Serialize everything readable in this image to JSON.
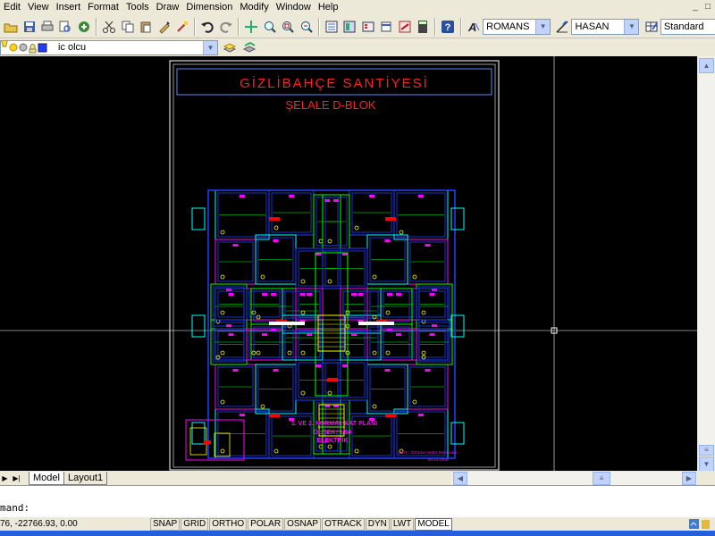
{
  "menu": [
    "Edit",
    "View",
    "Insert",
    "Format",
    "Tools",
    "Draw",
    "Dimension",
    "Modify",
    "Window",
    "Help"
  ],
  "window_controls": [
    "_",
    "□"
  ],
  "text_style": {
    "value": "ROMANS"
  },
  "dim_style": {
    "value": "HASAN"
  },
  "table_style": {
    "value": "Standard"
  },
  "layer": {
    "value": "ic olcu"
  },
  "drawing": {
    "title": "GİZLİBAHÇE   SANTİYESİ",
    "subtitle": "ŞELALE D-BLOK",
    "plan_label_1": "1. VE 2. NORMAL KAT PLANI",
    "plan_label_2": "ÖLÇEK: 1/50",
    "plan_label_3": "ELEKTRİK",
    "author": "ÇİZİT : Öztürker Nebiz Mühendisi",
    "date": "08.04.2008",
    "colors": {
      "frame": "#ffffff",
      "title_frame": "#5b8cff",
      "title": "#ff2020",
      "plan_text": "#ff00ff",
      "stroke_blue": "#2040ff",
      "stroke_cyan": "#00ffff",
      "stroke_green": "#00ff00",
      "stroke_magenta": "#ff00ff",
      "stroke_yellow": "#ffff00",
      "stroke_red": "#ff0000"
    }
  },
  "tabs": [
    {
      "label": "Model",
      "active": true
    },
    {
      "label": "Layout1",
      "active": false
    }
  ],
  "command": {
    "prompt": "mand:"
  },
  "status": {
    "coords": "76, -22766.93, 0.00",
    "toggles": [
      "SNAP",
      "GRID",
      "ORTHO",
      "POLAR",
      "OSNAP",
      "OTRACK",
      "DYN",
      "LWT",
      "MODEL"
    ]
  }
}
